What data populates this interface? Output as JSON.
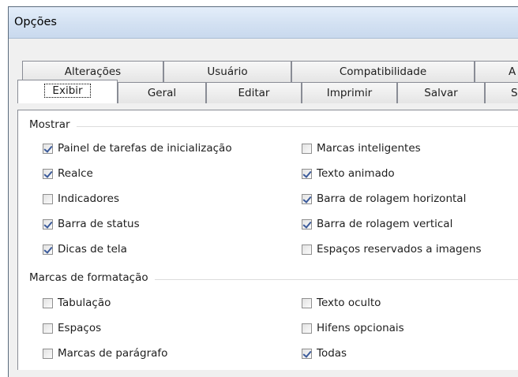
{
  "window": {
    "title": "Opções"
  },
  "tabs_back": [
    {
      "label": "Alterações"
    },
    {
      "label": "Usuário"
    },
    {
      "label": "Compatibilidade"
    },
    {
      "label": "A"
    }
  ],
  "tabs_front": [
    {
      "label": "Exibir",
      "selected": true
    },
    {
      "label": "Geral"
    },
    {
      "label": "Editar"
    },
    {
      "label": "Imprimir"
    },
    {
      "label": "Salvar"
    },
    {
      "label": "S"
    }
  ],
  "groups": {
    "mostrar": {
      "title": "Mostrar",
      "options": [
        {
          "label": "Painel de tarefas de inicialização",
          "checked": true
        },
        {
          "label": "Marcas inteligentes",
          "checked": false
        },
        {
          "label": "Realce",
          "checked": true
        },
        {
          "label": "Texto animado",
          "checked": true
        },
        {
          "label": "Indicadores",
          "checked": false
        },
        {
          "label": "Barra de rolagem horizontal",
          "checked": true
        },
        {
          "label": "Barra de status",
          "checked": true
        },
        {
          "label": "Barra de rolagem vertical",
          "checked": true
        },
        {
          "label": "Dicas de tela",
          "checked": true
        },
        {
          "label": "Espaços reservados a imagens",
          "checked": false
        }
      ]
    },
    "formatacao": {
      "title": "Marcas de formatação",
      "options": [
        {
          "label": "Tabulação",
          "checked": false
        },
        {
          "label": "Texto oculto",
          "checked": false
        },
        {
          "label": "Espaços",
          "checked": false
        },
        {
          "label": "Hifens opcionais",
          "checked": false
        },
        {
          "label": "Marcas de parágrafo",
          "checked": false
        },
        {
          "label": "Todas",
          "checked": true
        }
      ]
    }
  }
}
